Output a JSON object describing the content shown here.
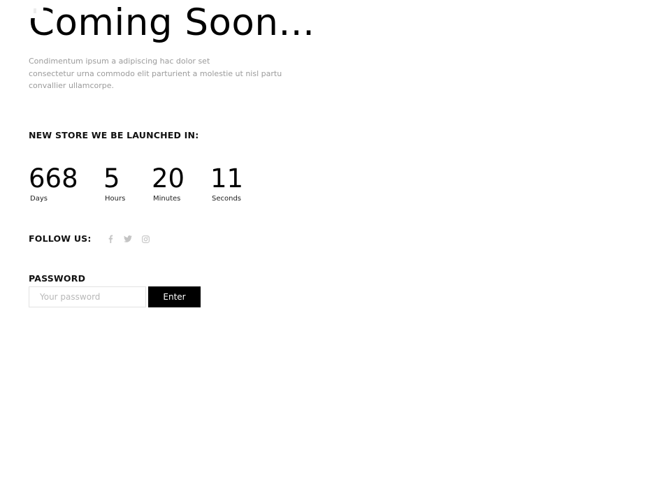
{
  "hero": {
    "title": "Coming Soon...",
    "description_lines": [
      "Condimentum ipsum a adipiscing hac dolor set",
      "consectetur urna commodo elit parturient a molestie ut nisl partu",
      "convallier ullamcorpe."
    ]
  },
  "countdown": {
    "label": "NEW STORE WE BE LAUNCHED IN:",
    "units": [
      {
        "value": "668",
        "label": "Days"
      },
      {
        "value": "5",
        "label": "Hours"
      },
      {
        "value": "20",
        "label": "Minutes"
      },
      {
        "value": "11",
        "label": "Seconds"
      }
    ]
  },
  "social": {
    "label": "FOLLOW US:",
    "icons": [
      "facebook-icon",
      "twitter-icon",
      "instagram-icon"
    ],
    "icon_color": "#c4c4c4"
  },
  "password": {
    "label": "PASSWORD",
    "placeholder": "Your password",
    "value": "",
    "submit_label": "Enter"
  },
  "colors": {
    "text": "#000000",
    "muted": "#9b9b9b",
    "button_bg": "#000000",
    "button_text": "#ffffff"
  }
}
